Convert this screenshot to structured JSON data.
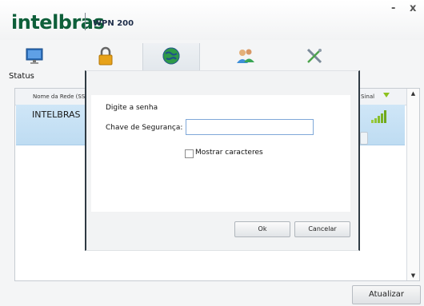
{
  "window": {
    "brand": "intelbras",
    "model": "WPN 200",
    "minimize": "-",
    "close": "x"
  },
  "toolbar": {
    "items": [
      {
        "label": "Status",
        "icon": "monitor-icon"
      },
      {
        "label": "",
        "icon": "lock-icon"
      },
      {
        "label": "",
        "icon": "network-globe-icon"
      },
      {
        "label": "",
        "icon": "users-icon"
      },
      {
        "label": "",
        "icon": "tools-icon"
      }
    ]
  },
  "list": {
    "col_name": "Nome da Rede (SS",
    "col_signal": "Sinal",
    "rows": [
      {
        "name": "INTELBRAS"
      }
    ]
  },
  "dialog": {
    "title": "Digite a senha",
    "key_label": "Chave de Segurança:",
    "key_value": "",
    "show_chars_label": "Mostrar caracteres",
    "show_chars_checked": false,
    "ok": "Ok",
    "cancel": "Cancelar"
  },
  "footer": {
    "refresh": "Atualizar"
  },
  "colors": {
    "brand_green": "#0e5f3a",
    "row_selected": "#c6e0f5",
    "signal_green": "#8dc21f"
  }
}
